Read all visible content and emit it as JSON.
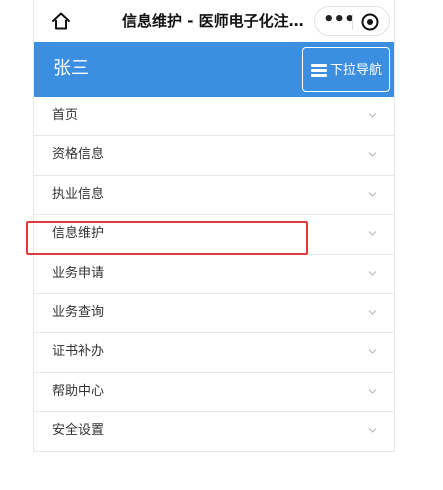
{
  "topbar": {
    "title": "信息维护 - 医师电子化注…",
    "icons": {
      "home": "home-icon",
      "more": "more-icon",
      "close": "close-icon"
    },
    "more_glyph": "•••"
  },
  "header": {
    "user_name": "张三",
    "nav_toggle_label": "下拉导航",
    "background_color": "#3c8fe0"
  },
  "menu": {
    "items": [
      {
        "label": "首页"
      },
      {
        "label": "资格信息"
      },
      {
        "label": "执业信息"
      },
      {
        "label": "信息维护",
        "highlighted": true
      },
      {
        "label": "业务申请"
      },
      {
        "label": "业务查询"
      },
      {
        "label": "证书补办"
      },
      {
        "label": "帮助中心"
      },
      {
        "label": "安全设置"
      }
    ]
  },
  "annotation": {
    "highlight_color": "#e23a3a",
    "highlighted_item": "信息维护"
  }
}
